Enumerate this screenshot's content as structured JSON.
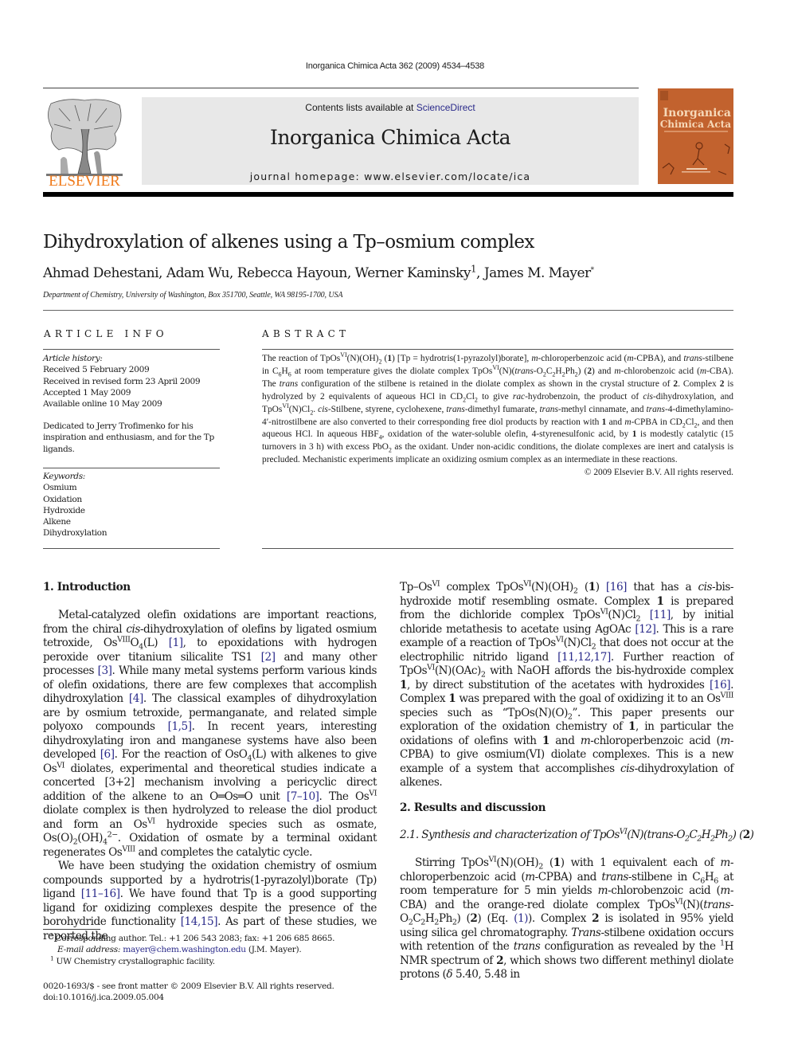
{
  "header": {
    "running_head": "Inorganica Chimica Acta 362 (2009) 4534–4538",
    "contents_prefix": "Contents lists available at ",
    "contents_link": "ScienceDirect",
    "journal_name": "Inorganica Chimica Acta",
    "homepage": "journal homepage: www.elsevier.com/locate/ica",
    "publisher": "ELSEVIER",
    "cover_title_line1": "Inorganica",
    "cover_title_line2": "Chimica Acta",
    "colors": {
      "publisher_orange": "#f07a1a",
      "cover_orange": "#c2622e",
      "masthead_gray": "#e8e8e8",
      "link_blue": "#2a2a8a"
    }
  },
  "article": {
    "title": "Dihydroxylation of alkenes using a Tp–osmium complex",
    "authors": [
      {
        "name": "Ahmad Dehestani",
        "mark": ""
      },
      {
        "name": "Adam Wu",
        "mark": ""
      },
      {
        "name": "Rebecca Hayoun",
        "mark": ""
      },
      {
        "name": "Werner Kaminsky",
        "mark": "1"
      },
      {
        "name": "James M. Mayer",
        "mark": "*"
      }
    ],
    "affiliation": "Department of Chemistry, University of Washington, Box 351700, Seattle, WA 98195-1700, USA"
  },
  "article_info": {
    "heading": "ARTICLE INFO",
    "history_label": "Article history:",
    "history": [
      "Received 5 February 2009",
      "Received in revised form 23 April 2009",
      "Accepted 1 May 2009",
      "Available online 10 May 2009"
    ],
    "dedication": "Dedicated to Jerry Trofimenko for his inspiration and enthusiasm, and for the Tp ligands.",
    "keywords_label": "Keywords:",
    "keywords": [
      "Osmium",
      "Oxidation",
      "Hydroxide",
      "Alkene",
      "Dihydroxylation"
    ]
  },
  "abstract": {
    "heading": "ABSTRACT",
    "copyright": "© 2009 Elsevier B.V. All rights reserved."
  },
  "sections": {
    "intro_heading": "1. Introduction",
    "results_heading": "2. Results and discussion",
    "subsection_heading_prefix": "2.1. Synthesis and characterization of "
  },
  "footnotes": {
    "corresponding": "Corresponding author. Tel.: +1 206 543 2083; fax: +1 206 685 8665.",
    "email_label": "E-mail address:",
    "email": "mayer@chem.washington.edu",
    "email_suffix": " (J.M. Mayer).",
    "fn1": "UW Chemistry crystallographic facility.",
    "front_matter": "0020-1693/$ - see front matter © 2009 Elsevier B.V. All rights reserved.",
    "doi": "doi:10.1016/j.ica.2009.05.004"
  }
}
